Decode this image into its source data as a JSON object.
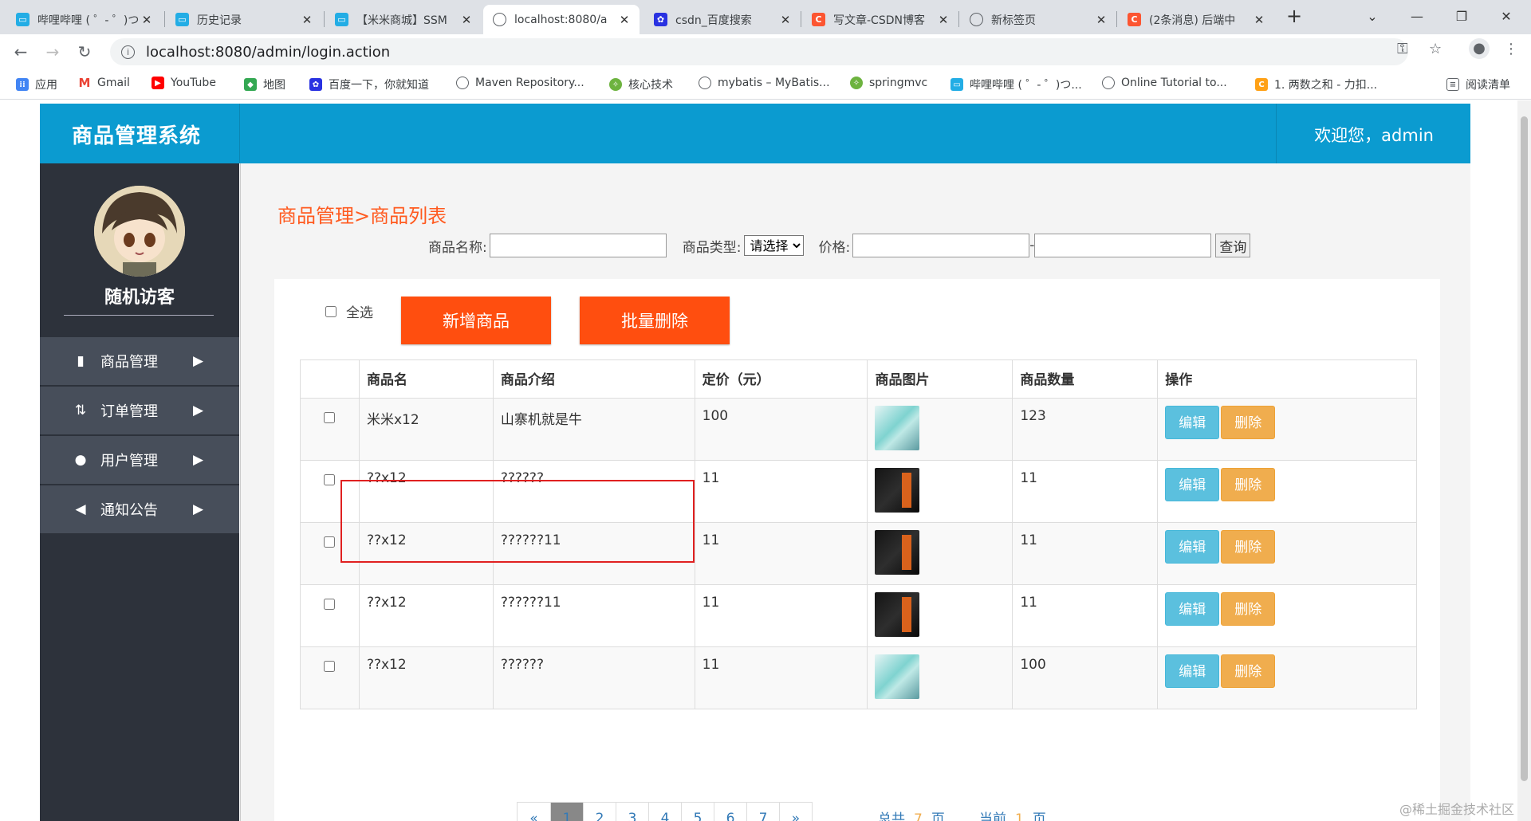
{
  "browser": {
    "tabs": [
      {
        "title": "哔哩哔哩 ( ゜- ゜)つロ",
        "icon": "bilibili-icon",
        "color": "#23ade5"
      },
      {
        "title": "历史记录",
        "icon": "bilibili-icon",
        "color": "#23ade5"
      },
      {
        "title": "【米米商城】SSM",
        "icon": "bilibili-icon",
        "color": "#23ade5"
      },
      {
        "title": "localhost:8080/a",
        "icon": "globe-icon",
        "color": "#5f6368"
      },
      {
        "title": "csdn_百度搜索",
        "icon": "baidu-icon",
        "color": "#2932e1"
      },
      {
        "title": "写文章-CSDN博客",
        "icon": "csdn-icon",
        "color": "#fc5531"
      },
      {
        "title": "新标签页",
        "icon": "globe-icon",
        "color": "#5f6368"
      },
      {
        "title": "(2条消息) 后端中",
        "icon": "csdn-icon",
        "color": "#fc5531"
      }
    ],
    "url": "localhost:8080/admin/login.action",
    "bookmarks": [
      {
        "label": "应用",
        "icon": "apps-grid-icon",
        "color": "#4285f4"
      },
      {
        "label": "Gmail",
        "icon": "gmail-icon",
        "color": "#ea4335"
      },
      {
        "label": "YouTube",
        "icon": "youtube-icon",
        "color": "#ff0000"
      },
      {
        "label": "地图",
        "icon": "maps-icon",
        "color": "#34a853"
      },
      {
        "label": "百度一下，你就知道",
        "icon": "baidu-icon",
        "color": "#2932e1"
      },
      {
        "label": "Maven Repository...",
        "icon": "globe-icon",
        "color": "#5f6368"
      },
      {
        "label": "核心技术",
        "icon": "spring-icon",
        "color": "#6db33f"
      },
      {
        "label": "mybatis – MyBatis...",
        "icon": "globe-icon",
        "color": "#5f6368"
      },
      {
        "label": "springmvc",
        "icon": "spring-icon",
        "color": "#6db33f"
      },
      {
        "label": "哔哩哔哩 ( ゜- ゜)つ...",
        "icon": "bilibili-icon",
        "color": "#23ade5"
      },
      {
        "label": "Online Tutorial to...",
        "icon": "globe-icon",
        "color": "#5f6368"
      },
      {
        "label": "1. 两数之和 - 力扣...",
        "icon": "leetcode-icon",
        "color": "#ffa116"
      }
    ],
    "reading_list": "阅读清单"
  },
  "app": {
    "title": "商品管理系统",
    "welcome": "欢迎您，admin",
    "brand_color": "#0b9bd0",
    "user_name": "随机访客",
    "menu": [
      {
        "label": "商品管理",
        "icon": "book-icon"
      },
      {
        "label": "订单管理",
        "icon": "sort-icon"
      },
      {
        "label": "用户管理",
        "icon": "user-icon"
      },
      {
        "label": "通知公告",
        "icon": "megaphone-icon"
      }
    ]
  },
  "main": {
    "breadcrumb": "商品管理>商品列表",
    "search": {
      "name_label": "商品名称:",
      "type_label": "商品类型:",
      "type_selected": "请选择",
      "price_label": "价格:",
      "price_sep": "-",
      "query_button": "查询"
    },
    "select_all": "全选",
    "add_button": "新增商品",
    "batch_delete_button": "批量删除",
    "table": {
      "headers": [
        "",
        "商品名",
        "商品介绍",
        "定价（元）",
        "商品图片",
        "商品数量",
        "操作"
      ],
      "rows": [
        {
          "name": "米米x12",
          "desc": "山寨机就是牛",
          "price": "100",
          "image": "teal",
          "qty": "123"
        },
        {
          "name": "??x12",
          "desc": "??????",
          "price": "11",
          "image": "dark",
          "qty": "11"
        },
        {
          "name": "??x12",
          "desc": "??????11",
          "price": "11",
          "image": "dark",
          "qty": "11"
        },
        {
          "name": "??x12",
          "desc": "??????11",
          "price": "11",
          "image": "dark",
          "qty": "11"
        },
        {
          "name": "??x12",
          "desc": "??????",
          "price": "11",
          "image": "teal",
          "qty": "100"
        }
      ],
      "edit_label": "编辑",
      "delete_label": "删除"
    },
    "pagination": {
      "prev": "«",
      "pages": [
        "1",
        "2",
        "3",
        "4",
        "5",
        "6",
        "7"
      ],
      "next": "»",
      "current_page": 1,
      "total_prefix": "总共",
      "total_pages": "7",
      "page_suffix": "页",
      "current_prefix": "当前",
      "current_value": "1"
    }
  },
  "watermark": "@稀土掘金技术社区"
}
